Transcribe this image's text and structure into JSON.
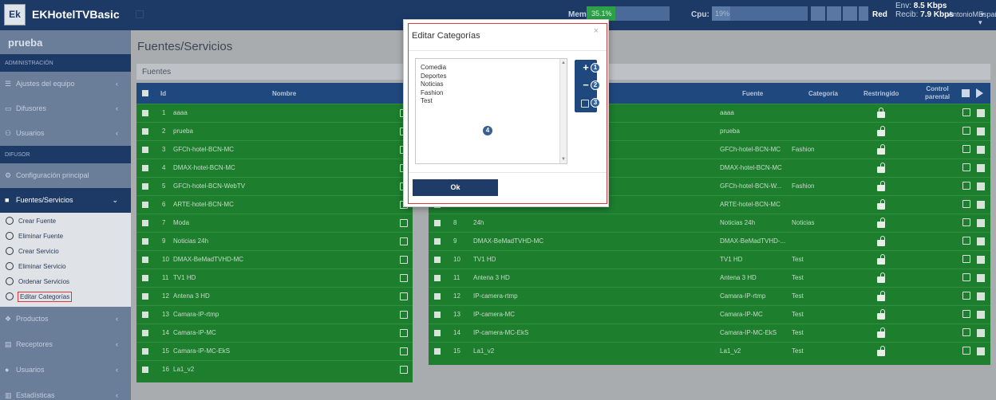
{
  "topbar": {
    "logo": "Ek",
    "app_title": "EKHotelTVBasic",
    "mem_label": "Mem:",
    "mem_value": "35.1%",
    "mem_fraction": 0.35,
    "cpu_label": "Cpu:",
    "cpu_value": "19%",
    "cpu_fraction": 0.19,
    "net_label": "Red",
    "env_label": "Env:",
    "env_value": "8.5 Kbps",
    "recib_label": "Recib:",
    "recib_value": "7.9 Kbps",
    "user": "AntonioM ▾",
    "language": "Español ▾"
  },
  "sidebar": {
    "user": "prueba",
    "section_admin": "ADMINISTRACIÓN",
    "admin_items": [
      {
        "label": "Ajustes del equipo",
        "icon": "sliders-icon"
      },
      {
        "label": "Difusores",
        "icon": "monitor-icon"
      },
      {
        "label": "Usuarios",
        "icon": "users-icon"
      }
    ],
    "section_difusor": "DIFUSOR",
    "config_item": "Configuración principal",
    "fuentes_item": "Fuentes/Servicios",
    "sub_items": [
      "Crear Fuente",
      "Eliminar Fuente",
      "Crear Servicio",
      "Eliminar Servicio",
      "Ordenar Servicios",
      "Editar Categorías"
    ],
    "bottom_items": [
      {
        "label": "Productos",
        "icon": "cubes-icon"
      },
      {
        "label": "Receptores",
        "icon": "receiver-icon"
      },
      {
        "label": "Usuarios",
        "icon": "user-icon"
      },
      {
        "label": "Estadísticas",
        "icon": "chart-icon"
      }
    ]
  },
  "main": {
    "title": "Fuentes/Servicios",
    "panel_title": "Fuentes",
    "sources_headers": {
      "id": "Id",
      "name": "Nombre"
    },
    "sources": [
      {
        "id": "1",
        "name": "aaaa"
      },
      {
        "id": "2",
        "name": "prueba"
      },
      {
        "id": "3",
        "name": "GFCh-hotel-BCN-MC"
      },
      {
        "id": "4",
        "name": "DMAX-hotel-BCN-MC"
      },
      {
        "id": "5",
        "name": "GFCh-hotel-BCN-WebTV"
      },
      {
        "id": "6",
        "name": "ARTE-hotel-BCN-MC"
      },
      {
        "id": "7",
        "name": "Moda"
      },
      {
        "id": "9",
        "name": "Noticias 24h"
      },
      {
        "id": "10",
        "name": "DMAX-BeMadTVHD-MC"
      },
      {
        "id": "11",
        "name": "TV1 HD"
      },
      {
        "id": "12",
        "name": "Antena 3 HD"
      },
      {
        "id": "13",
        "name": "Camara-IP-rtmp"
      },
      {
        "id": "14",
        "name": "Camara-IP-MC"
      },
      {
        "id": "15",
        "name": "Camara-IP-MC-EkS"
      },
      {
        "id": "16",
        "name": "La1_v2"
      }
    ],
    "services_headers": {
      "fuente": "Fuente",
      "categoria": "Categoría",
      "restringido": "Restringido",
      "control_line1": "Control",
      "control_line2": "parental"
    },
    "services": [
      {
        "id": "",
        "name": "",
        "fuente": "aaaa",
        "categoria": "",
        "locked": true
      },
      {
        "id": "",
        "name": "",
        "fuente": "prueba",
        "categoria": "",
        "locked": false
      },
      {
        "id": "",
        "name": "",
        "fuente": "GFCh-hotel-BCN-MC",
        "categoria": "Fashion",
        "locked": false
      },
      {
        "id": "",
        "name": "",
        "fuente": "DMAX-hotel-BCN-MC",
        "categoria": "",
        "locked": false
      },
      {
        "id": "",
        "name": "",
        "fuente": "GFCh-hotel-BCN-W...",
        "categoria": "Fashion",
        "locked": false
      },
      {
        "id": "6",
        "name": "ARTE-hotel-BCN-MC",
        "fuente": "ARTE-hotel-BCN-MC",
        "categoria": "",
        "locked": false
      },
      {
        "id": "8",
        "name": "24h",
        "fuente": "Noticias 24h",
        "categoria": "Noticias",
        "locked": false
      },
      {
        "id": "9",
        "name": "DMAX-BeMadTVHD-MC",
        "fuente": "DMAX-BeMadTVHD-...",
        "categoria": "",
        "locked": false
      },
      {
        "id": "10",
        "name": "TV1 HD",
        "fuente": "TV1 HD",
        "categoria": "Test",
        "locked": false
      },
      {
        "id": "11",
        "name": "Antena 3 HD",
        "fuente": "Antena 3 HD",
        "categoria": "Test",
        "locked": false
      },
      {
        "id": "12",
        "name": "IP-camera-rtmp",
        "fuente": "Camara-IP-rtmp",
        "categoria": "Test",
        "locked": false
      },
      {
        "id": "13",
        "name": "IP-camera-MC",
        "fuente": "Camara-IP-MC",
        "categoria": "Test",
        "locked": false
      },
      {
        "id": "14",
        "name": "IP-camera-MC-EkS",
        "fuente": "Camara-IP-MC-EkS",
        "categoria": "Test",
        "locked": false
      },
      {
        "id": "15",
        "name": "La1_v2",
        "fuente": "La1_v2",
        "categoria": "Test",
        "locked": false
      }
    ]
  },
  "modal": {
    "title": "Editar Categorías",
    "close": "×",
    "categories": [
      "Comedia",
      "Deportes",
      "Noticias",
      "Fashion",
      "Test"
    ],
    "add_label": "+",
    "remove_label": "−",
    "badges": [
      "1",
      "2",
      "3",
      "4"
    ],
    "ok_label": "Ok"
  },
  "colors": {
    "navy": "#1d3a67",
    "row_green": "#1d7e2e",
    "header_blue": "#1f487e",
    "highlight_red": "#d93a3a"
  }
}
